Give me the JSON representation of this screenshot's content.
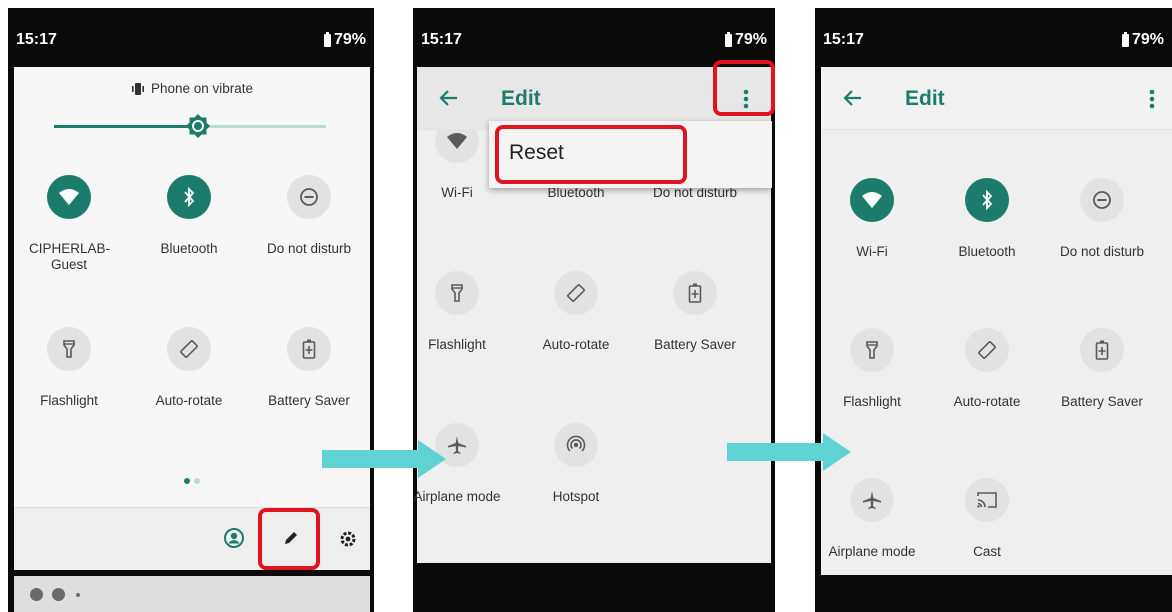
{
  "status": {
    "time": "15:17",
    "battery": "79%"
  },
  "panel1": {
    "ringer": "Phone on vibrate",
    "brightness_level": 0.55,
    "tiles": [
      {
        "label": "CIPHERLAB-Guest",
        "icon": "wifi-icon",
        "active": true
      },
      {
        "label": "Bluetooth",
        "icon": "bluetooth-icon",
        "active": true
      },
      {
        "label": "Do not disturb",
        "icon": "do-not-disturb-icon",
        "active": false
      },
      {
        "label": "Flashlight",
        "icon": "flashlight-icon",
        "active": false
      },
      {
        "label": "Auto-rotate",
        "icon": "auto-rotate-icon",
        "active": false
      },
      {
        "label": "Battery Saver",
        "icon": "battery-saver-icon",
        "active": false
      }
    ],
    "page_indicator": {
      "pages": 2,
      "current": 1
    },
    "footer_icons": [
      "user-icon",
      "edit-pencil-icon",
      "settings-icon"
    ]
  },
  "panel2": {
    "title": "Edit",
    "menu_item": "Reset",
    "tiles": [
      {
        "label": "Wi-Fi",
        "icon": "wifi-icon"
      },
      {
        "label": "Bluetooth",
        "icon": "bluetooth-icon"
      },
      {
        "label": "Do not disturb",
        "icon": "do-not-disturb-icon"
      },
      {
        "label": "Flashlight",
        "icon": "flashlight-icon"
      },
      {
        "label": "Auto-rotate",
        "icon": "auto-rotate-icon"
      },
      {
        "label": "Battery Saver",
        "icon": "battery-saver-icon"
      },
      {
        "label": "Airplane mode",
        "icon": "airplane-icon"
      },
      {
        "label": "Hotspot",
        "icon": "hotspot-icon"
      }
    ]
  },
  "panel3": {
    "title": "Edit",
    "tiles": [
      {
        "label": "Wi-Fi",
        "icon": "wifi-icon",
        "active": true
      },
      {
        "label": "Bluetooth",
        "icon": "bluetooth-icon",
        "active": true
      },
      {
        "label": "Do not disturb",
        "icon": "do-not-disturb-icon",
        "active": false
      },
      {
        "label": "Flashlight",
        "icon": "flashlight-icon",
        "active": false
      },
      {
        "label": "Auto-rotate",
        "icon": "auto-rotate-icon",
        "active": false
      },
      {
        "label": "Battery Saver",
        "icon": "battery-saver-icon",
        "active": false
      },
      {
        "label": "Airplane mode",
        "icon": "airplane-icon",
        "active": false
      },
      {
        "label": "Cast",
        "icon": "cast-icon",
        "active": false
      }
    ]
  },
  "colors": {
    "accent": "#1b7c6b",
    "highlight": "#e0141e",
    "arrow": "#5fd3d3"
  }
}
